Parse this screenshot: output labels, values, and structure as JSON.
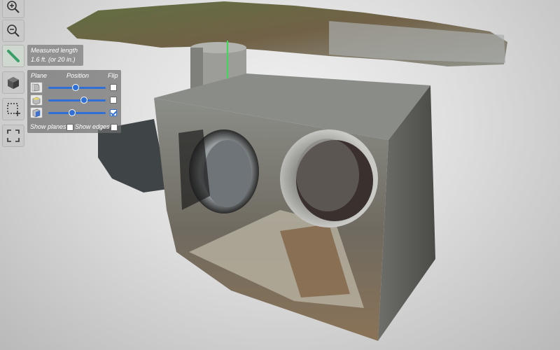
{
  "toolbar": {
    "items": [
      {
        "name": "zoom-in-button",
        "icon": "zoom-in-icon"
      },
      {
        "name": "zoom-out-button",
        "icon": "zoom-out-icon"
      },
      {
        "name": "measure-button",
        "icon": "ruler-icon"
      },
      {
        "name": "view-cube-button",
        "icon": "cube-icon"
      },
      {
        "name": "box-select-button",
        "icon": "box-select-icon"
      },
      {
        "name": "fit-view-button",
        "icon": "fullscreen-icon"
      }
    ]
  },
  "measurement": {
    "title": "Measured length",
    "value": "1.6 ft. (or 20 in.)"
  },
  "clipping": {
    "headers": {
      "plane": "Plane",
      "position": "Position",
      "flip": "Flip"
    },
    "planes": [
      {
        "icon": "plane-x-icon",
        "position": 0.48,
        "flip": false
      },
      {
        "icon": "plane-y-icon",
        "position": 0.62,
        "flip": false
      },
      {
        "icon": "plane-z-icon",
        "position": 0.42,
        "flip": true
      }
    ],
    "show_planes_label": "Show planes",
    "show_edges_label": "Show edges",
    "show_planes": false,
    "show_edges": false
  },
  "colors": {
    "accent": "#2f6fd6",
    "measure_line": "#3ddc54"
  }
}
